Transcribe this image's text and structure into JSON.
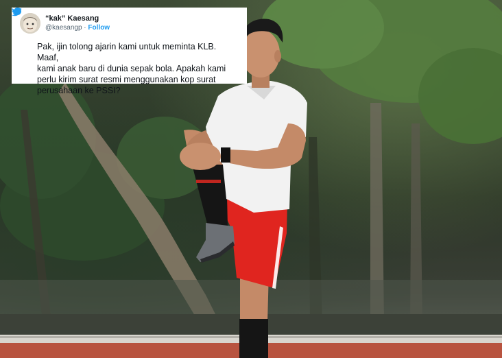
{
  "tweet": {
    "display_name": "“kak” Kaesang",
    "handle": "@kaesangp",
    "separator": " · ",
    "follow_label": "Follow",
    "text": "Pak, ijin tolong ajarin kami untuk meminta KLB. Maaf,\nkami anak baru di dunia sepak bola. Apakah kami\nperlu kirim surat resmi menggunakan kop surat\nperusahaan ke PSSI?",
    "icons": {
      "verified": "verified-badge-icon",
      "logo": "twitter-bird-icon"
    },
    "colors": {
      "link": "#1d9bf0",
      "card_background": "#ffffff",
      "text": "#0f1419",
      "secondary_text": "#536471"
    }
  },
  "photo": {
    "colors": {
      "jersey": "#f2f2f2",
      "shorts": "#e0251f",
      "track": "#b8533f",
      "foliage": "#4f7a3c"
    }
  }
}
